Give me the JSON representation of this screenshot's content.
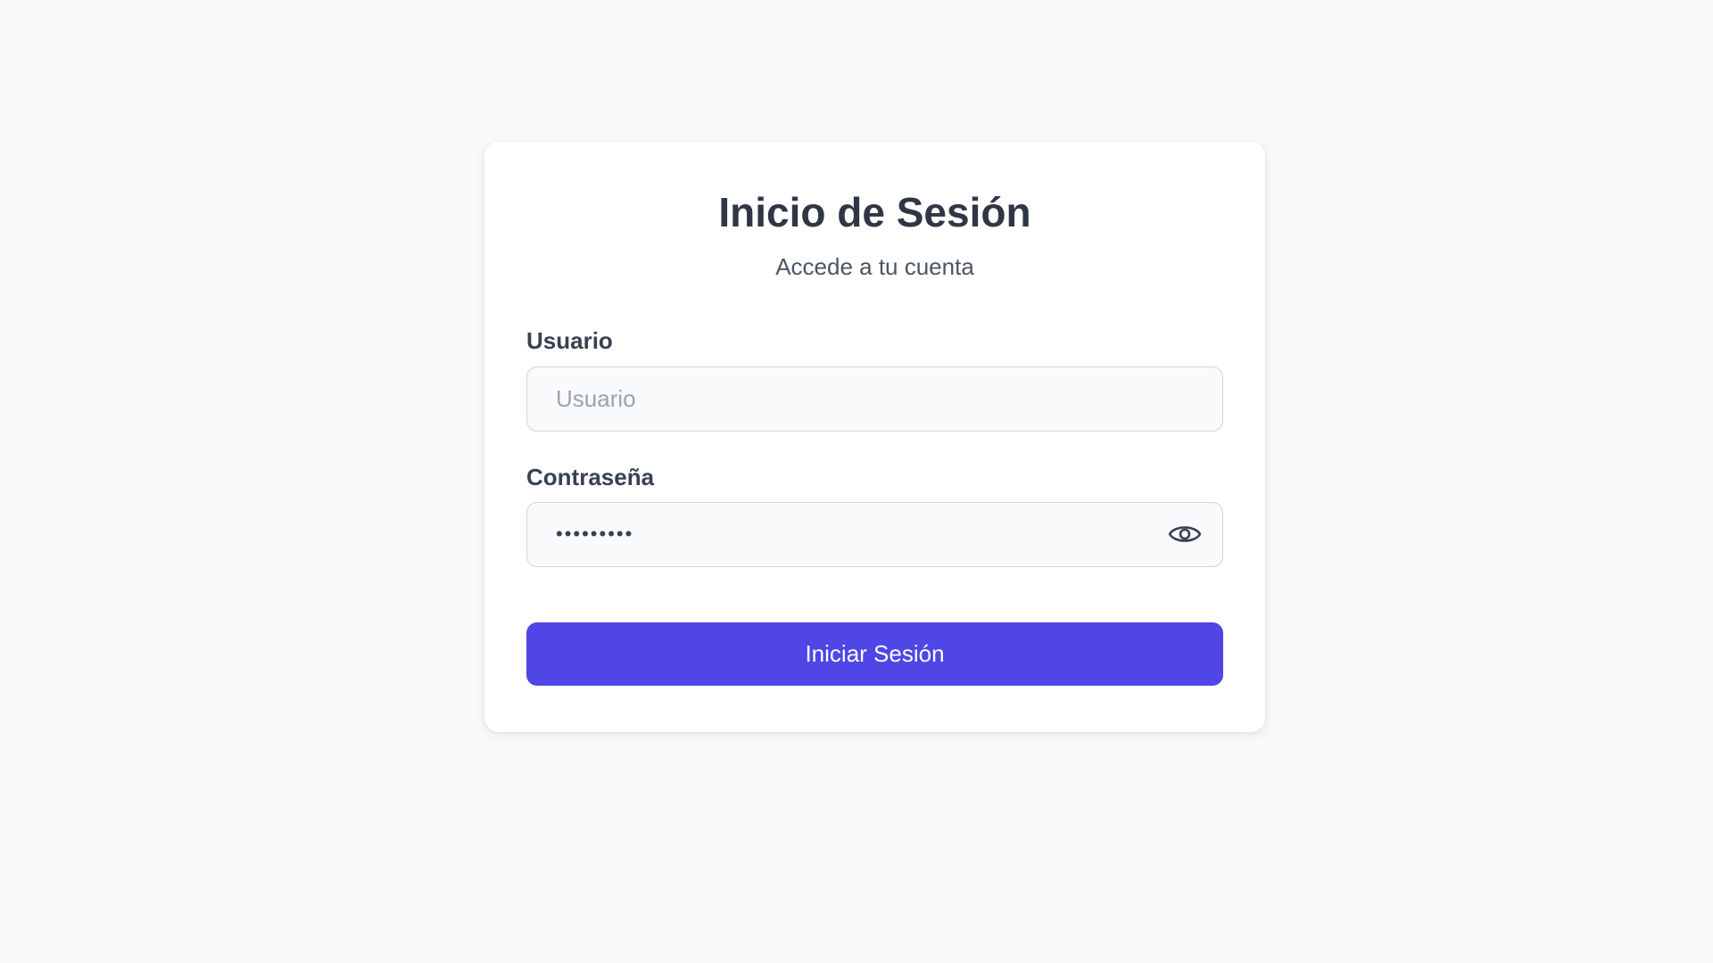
{
  "login": {
    "title": "Inicio de Sesión",
    "subtitle": "Accede a tu cuenta",
    "username": {
      "label": "Usuario",
      "placeholder": "Usuario",
      "value": ""
    },
    "password": {
      "label": "Contraseña",
      "value": "password1",
      "toggle_icon": "eye-icon"
    },
    "submit_label": "Iniciar Sesión"
  },
  "colors": {
    "background": "#f8f9fb",
    "card": "#ffffff",
    "accent": "#4f46e5",
    "input_border": "#d1d5db",
    "input_background": "#f9fafb"
  }
}
